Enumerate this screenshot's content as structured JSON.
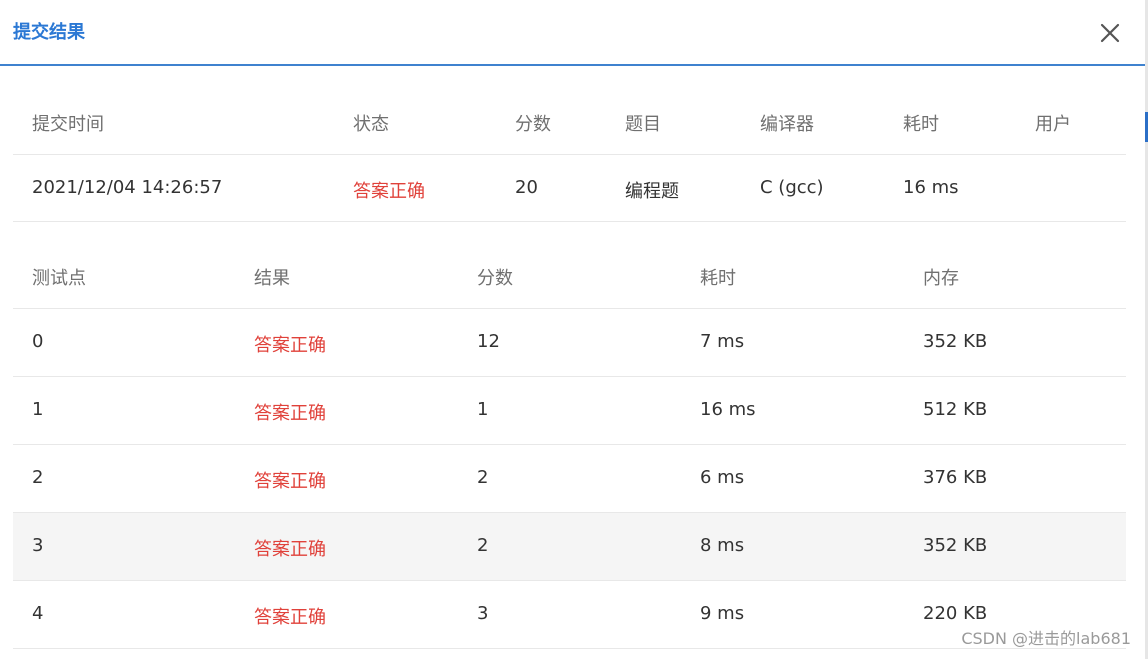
{
  "dialog": {
    "title": "提交结果",
    "close_icon": "close-icon"
  },
  "summary": {
    "headers": [
      "提交时间",
      "状态",
      "分数",
      "题目",
      "编译器",
      "耗时",
      "用户"
    ],
    "row": {
      "time": "2021/12/04 14:26:57",
      "status": "答案正确",
      "score": "20",
      "problem": "编程题",
      "compiler": "C (gcc)",
      "duration": "16 ms",
      "user": ""
    }
  },
  "tests": {
    "headers": [
      "测试点",
      "结果",
      "分数",
      "耗时",
      "内存"
    ],
    "rows": [
      {
        "id": "0",
        "result": "答案正确",
        "score": "12",
        "time": "7 ms",
        "memory": "352 KB"
      },
      {
        "id": "1",
        "result": "答案正确",
        "score": "1",
        "time": "16 ms",
        "memory": "512 KB"
      },
      {
        "id": "2",
        "result": "答案正确",
        "score": "2",
        "time": "6 ms",
        "memory": "376 KB"
      },
      {
        "id": "3",
        "result": "答案正确",
        "score": "2",
        "time": "8 ms",
        "memory": "352 KB"
      },
      {
        "id": "4",
        "result": "答案正确",
        "score": "3",
        "time": "9 ms",
        "memory": "220 KB"
      }
    ]
  },
  "colors": {
    "accent": "#2b78d4",
    "correct": "#e0413a"
  },
  "watermark": "CSDN @进击的lab681"
}
